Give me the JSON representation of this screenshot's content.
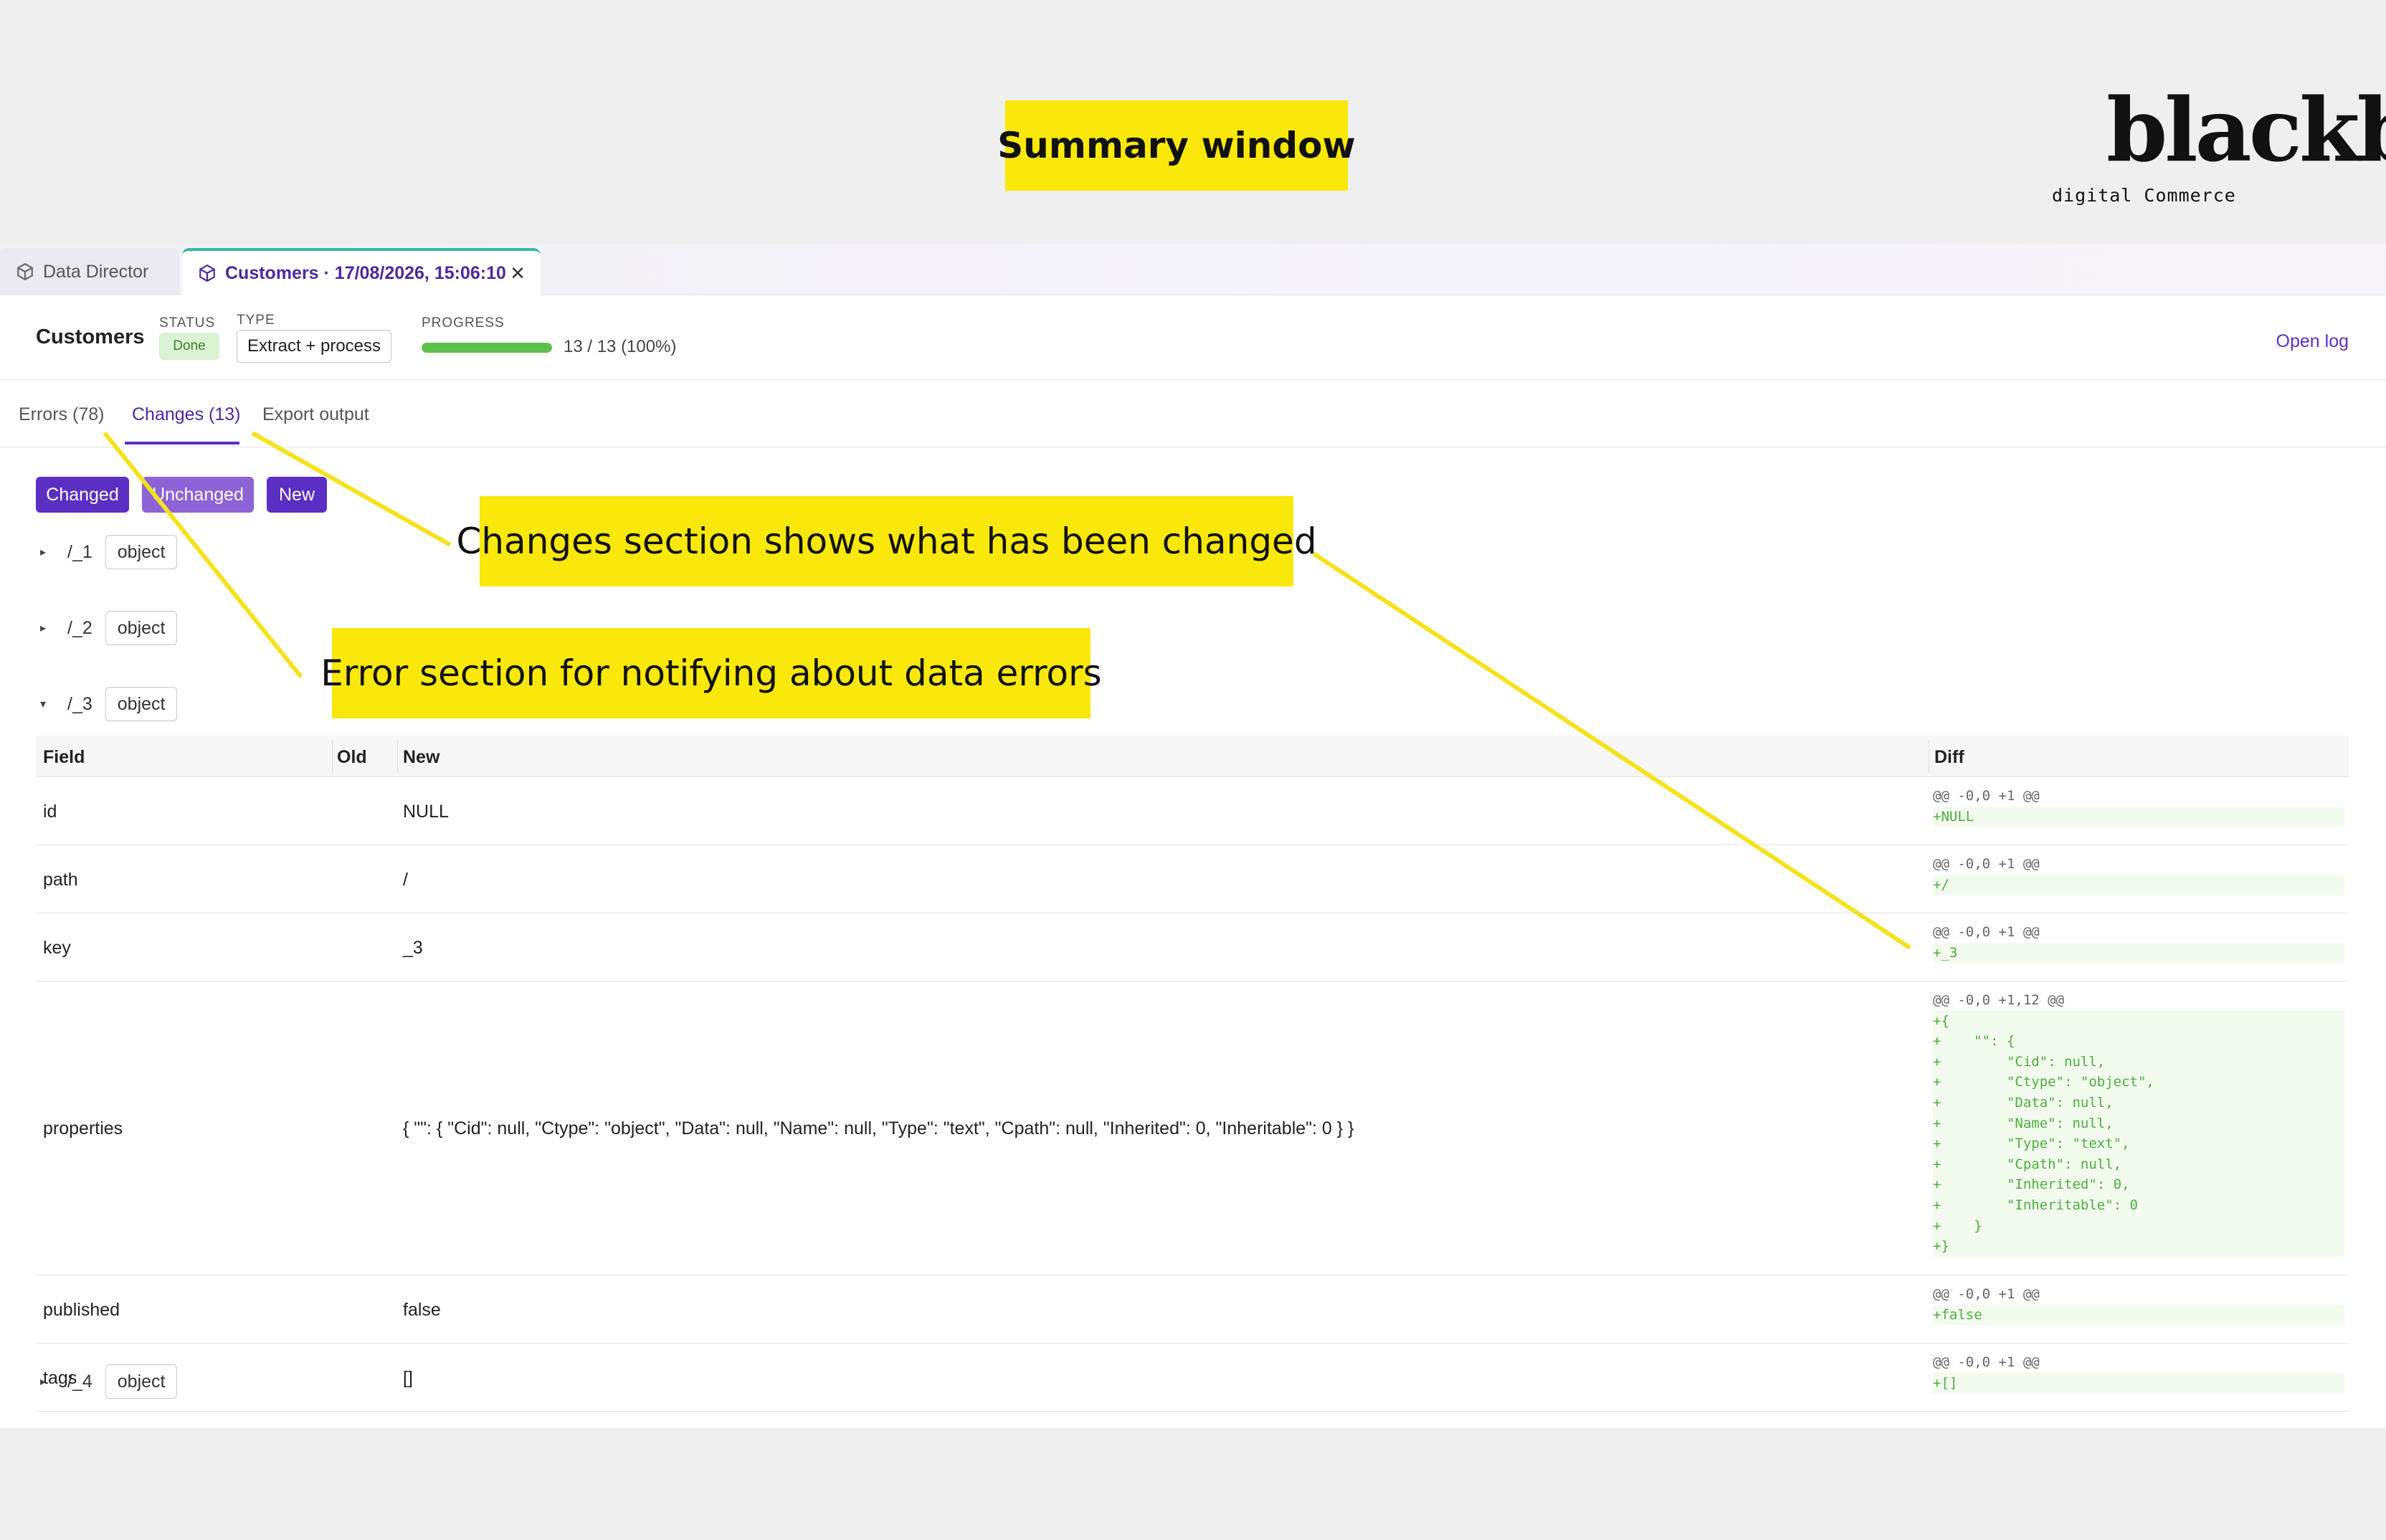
{
  "callouts": {
    "summary": "Summary window",
    "changes": "Changes section shows what has been changed",
    "errors": "Error section for notifying about data errors"
  },
  "logo": {
    "mark": "blackbit",
    "tagline": "digital Commerce"
  },
  "window_tabs": [
    {
      "label": "Data Director",
      "icon": "cube-icon"
    },
    {
      "label": "Customers · 17/08/2026, 15:06:10",
      "icon": "cube-icon",
      "close": "×"
    }
  ],
  "job": {
    "title": "Customers",
    "status_label": "STATUS",
    "status": "Done",
    "type_label": "TYPE",
    "type": "Extract + process",
    "progress_label": "PROGRESS",
    "progress_value": 1.0,
    "progress_text": "13 / 13 (100%)",
    "open_log": "Open log"
  },
  "section_tabs": [
    {
      "label": "Errors (78)"
    },
    {
      "label": "Changes (13)",
      "active": true
    },
    {
      "label": "Export output"
    }
  ],
  "filters": [
    "Changed",
    "Unchanged",
    "New"
  ],
  "nodes": [
    {
      "path": "/_1",
      "type": "object",
      "expanded": false
    },
    {
      "path": "/_2",
      "type": "object",
      "expanded": false
    },
    {
      "path": "/_3",
      "type": "object",
      "expanded": true
    },
    {
      "path": "/_4",
      "type": "object",
      "expanded": false
    }
  ],
  "table": {
    "headers": [
      "Field",
      "Old",
      "New",
      "Diff"
    ],
    "rows": [
      {
        "field": "id",
        "old": "",
        "new": "NULL",
        "diff": [
          "@@ -0,0 +1 @@",
          "+NULL"
        ]
      },
      {
        "field": "path",
        "old": "",
        "new": "/",
        "diff": [
          "@@ -0,0 +1 @@",
          "+/"
        ]
      },
      {
        "field": "key",
        "old": "",
        "new": "_3",
        "diff": [
          "@@ -0,0 +1 @@",
          "+_3"
        ]
      },
      {
        "field": "properties",
        "old": "",
        "new": "{ \"\": { \"Cid\": null, \"Ctype\": \"object\", \"Data\": null, \"Name\": null, \"Type\": \"text\", \"Cpath\": null, \"Inherited\": 0, \"Inheritable\": 0 } }",
        "diff": [
          "@@ -0,0 +1,12 @@",
          "+{",
          "+    \"\": {",
          "+        \"Cid\": null,",
          "+        \"Ctype\": \"object\",",
          "+        \"Data\": null,",
          "+        \"Name\": null,",
          "+        \"Type\": \"text\",",
          "+        \"Cpath\": null,",
          "+        \"Inherited\": 0,",
          "+        \"Inheritable\": 0",
          "+    }",
          "+}"
        ]
      },
      {
        "field": "published",
        "old": "",
        "new": "false",
        "diff": [
          "@@ -0,0 +1 @@",
          "+false"
        ]
      },
      {
        "field": "tags",
        "old": "",
        "new": "[]",
        "diff": [
          "@@ -0,0 +1 @@",
          "+[]"
        ]
      }
    ]
  },
  "colors": {
    "accent": "#5b2fc4",
    "callout": "#fae80a",
    "success": "#5cc14a",
    "tab_indicator": "#34b8a6"
  }
}
